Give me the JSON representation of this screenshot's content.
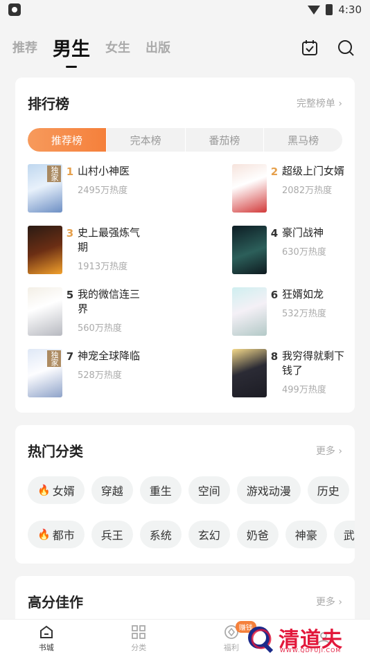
{
  "status": {
    "time": "4:30"
  },
  "top_tabs": [
    "推荐",
    "男生",
    "女生",
    "出版"
  ],
  "ranking": {
    "title": "排行榜",
    "more": "完整榜单",
    "segments": [
      "推荐榜",
      "完本榜",
      "番茄榜",
      "黑马榜"
    ],
    "items": [
      {
        "rank": "1",
        "name": "山村小神医",
        "heat": "2495万热度",
        "badge": "独家",
        "cover_text": "山村小神医"
      },
      {
        "rank": "2",
        "name": "超级上门女婿",
        "heat": "2082万热度",
        "badge": "",
        "cover_text": "超级上门女婿"
      },
      {
        "rank": "3",
        "name": "史上最强炼气期",
        "heat": "1913万热度",
        "badge": "",
        "cover_text": "炼气期"
      },
      {
        "rank": "4",
        "name": "豪门战神",
        "heat": "630万热度",
        "badge": "",
        "cover_text": "豪门战神"
      },
      {
        "rank": "5",
        "name": "我的微信连三界",
        "heat": "560万热度",
        "badge": "",
        "cover_text": "我的微信连三界"
      },
      {
        "rank": "6",
        "name": "狂婿如龙",
        "heat": "532万热度",
        "badge": "",
        "cover_text": "狂婿如龙"
      },
      {
        "rank": "7",
        "name": "神宠全球降临",
        "heat": "528万热度",
        "badge": "独家",
        "cover_text": "神宠全球降临"
      },
      {
        "rank": "8",
        "name": "我穷得就剩下钱了",
        "heat": "499万热度",
        "badge": "",
        "cover_text": "我穷得就剩下钱了"
      }
    ]
  },
  "categories": {
    "title": "热门分类",
    "more": "更多",
    "row1": [
      {
        "label": "女婿",
        "hot": true
      },
      {
        "label": "穿越",
        "hot": false
      },
      {
        "label": "重生",
        "hot": false
      },
      {
        "label": "空间",
        "hot": false
      },
      {
        "label": "游戏动漫",
        "hot": false
      },
      {
        "label": "历史",
        "hot": false
      }
    ],
    "row2": [
      {
        "label": "都市",
        "hot": true
      },
      {
        "label": "兵王",
        "hot": false
      },
      {
        "label": "系统",
        "hot": false
      },
      {
        "label": "玄幻",
        "hot": false
      },
      {
        "label": "奶爸",
        "hot": false
      },
      {
        "label": "神豪",
        "hot": false
      },
      {
        "label": "武侠",
        "hot": false
      }
    ]
  },
  "high_score": {
    "title": "高分佳作",
    "more": "更多"
  },
  "bottom_nav": [
    {
      "label": "书城",
      "icon": "home-icon"
    },
    {
      "label": "分类",
      "icon": "grid-icon"
    },
    {
      "label": "福利",
      "icon": "coin-icon",
      "badge": "赚钱"
    },
    {
      "label": "",
      "icon": "profile-icon"
    }
  ],
  "watermark": {
    "text": "清道夫",
    "url": "WWW.QDFUJI.COM"
  },
  "colors": {
    "accent": "#f5803b",
    "rank_top": "#e6a04c"
  }
}
